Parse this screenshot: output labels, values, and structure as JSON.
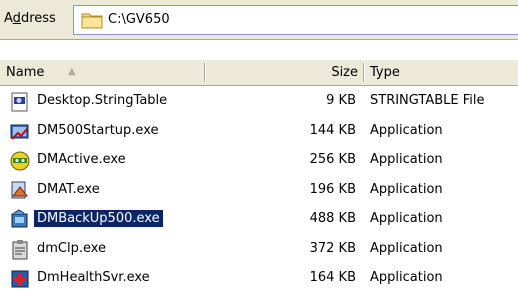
{
  "address": {
    "label_prefix": "A",
    "label_underlined": "d",
    "label_suffix": "dress",
    "value": "C:\\GV650"
  },
  "columns": {
    "name": "Name",
    "size": "Size",
    "type": "Type"
  },
  "rows": [
    {
      "name": "Desktop.StringTable",
      "size": "9 KB",
      "type": "STRINGTABLE File",
      "icon": "stringtable-file-icon",
      "selected": false
    },
    {
      "name": "DM500Startup.exe",
      "size": "144 KB",
      "type": "Application",
      "icon": "startup-app-icon",
      "selected": false
    },
    {
      "name": "DMActive.exe",
      "size": "256 KB",
      "type": "Application",
      "icon": "active-app-icon",
      "selected": false
    },
    {
      "name": "DMAT.exe",
      "size": "196 KB",
      "type": "Application",
      "icon": "dmat-app-icon",
      "selected": false
    },
    {
      "name": "DMBackUp500.exe",
      "size": "488 KB",
      "type": "Application",
      "icon": "backup-app-icon",
      "selected": true
    },
    {
      "name": "dmClp.exe",
      "size": "372 KB",
      "type": "Application",
      "icon": "clipboard-app-icon",
      "selected": false
    },
    {
      "name": "DmHealthSvr.exe",
      "size": "164 KB",
      "type": "Application",
      "icon": "health-server-app-icon",
      "selected": false
    }
  ],
  "colors": {
    "selection": "#0a246a",
    "chrome": "#ece9d8"
  }
}
